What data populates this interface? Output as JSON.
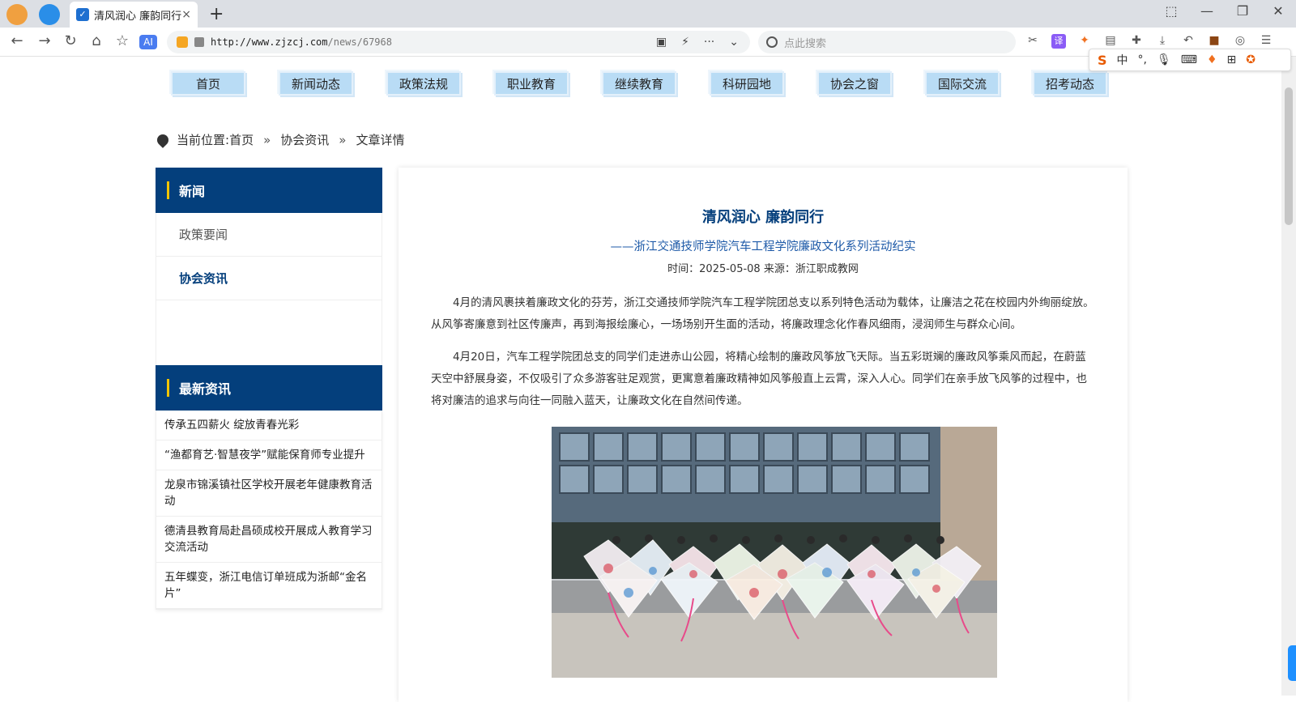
{
  "browser": {
    "tab_title": "清风润心 廉韵同行",
    "tab_close": "×",
    "new_tab": "+",
    "url_host": "http://www.zjzcj.com",
    "url_path": "/news/67968",
    "search_placeholder": "点此搜索",
    "ime": {
      "lang": "中"
    }
  },
  "nav": [
    "首页",
    "新闻动态",
    "政策法规",
    "职业教育",
    "继续教育",
    "科研园地",
    "协会之窗",
    "国际交流",
    "招考动态"
  ],
  "breadcrumb": {
    "prefix": "当前位置:",
    "home": "首页",
    "section": "协会资讯",
    "page": "文章详情",
    "sep": "»"
  },
  "sidebar": {
    "heading": "新闻",
    "items": [
      {
        "label": "政策要闻"
      },
      {
        "label": "协会资讯"
      }
    ],
    "latest_heading": "最新资讯",
    "latest": [
      "传承五四薪火 绽放青春光彩",
      "“渔都育艺·智慧夜学”赋能保育师专业提升",
      "龙泉市锦溪镇社区学校开展老年健康教育活动",
      "德清县教育局赴昌硕成校开展成人教育学习交流活动",
      "五年蝶变，浙江电信订单班成为浙邮“金名片”"
    ]
  },
  "article": {
    "title": "清风润心 廉韵同行",
    "subtitle": "——浙江交通技师学院汽车工程学院廉政文化系列活动纪实",
    "meta": "时间：2025-05-08  来源：浙江职成教网",
    "paragraphs": [
      "4月的清风裹挟着廉政文化的芬芳，浙江交通技师学院汽车工程学院团总支以系列特色活动为载体，让廉洁之花在校园内外绚丽绽放。从风筝寄廉意到社区传廉声，再到海报绘廉心，一场场别开生面的活动，将廉政理念化作春风细雨，浸润师生与群众心间。",
      "4月20日，汽车工程学院团总支的同学们走进赤山公园，将精心绘制的廉政风筝放飞天际。当五彩斑斓的廉政风筝乘风而起，在蔚蓝天空中舒展身姿，不仅吸引了众多游客驻足观赏，更寓意着廉政精神如风筝般直上云霄，深入人心。同学们在亲手放飞风筝的过程中，也将对廉洁的追求与向往一同融入蓝天，让廉政文化在自然间传递。"
    ]
  }
}
